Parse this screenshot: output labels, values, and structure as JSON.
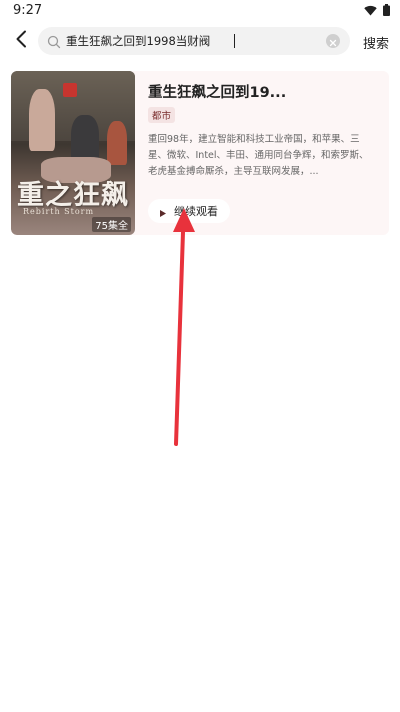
{
  "status_bar": {
    "time": "9:27",
    "icons": [
      "wifi-icon",
      "battery-icon"
    ]
  },
  "search": {
    "back_icon": "chevron-left-icon",
    "query": "重生狂飙之回到1998当财阀",
    "clear_icon": "clear-icon",
    "button_label": "搜索"
  },
  "result": {
    "poster_title_art": "重之狂飙",
    "poster_subtitle_art": "Rebirth Storm",
    "episode_badge": "75集全",
    "title": "重生狂飙之回到19...",
    "genre": "都市",
    "description": "重回98年，建立智能和科技工业帝国，和苹果、三星、微软、Intel、丰田、通用同台争辉，和索罗斯、老虎基金搏命厮杀，主导互联网发展，...",
    "continue_label": "继续观看"
  },
  "colors": {
    "card_background": "#fdf6f6",
    "genre_tag_background": "#f4e3e3",
    "genre_tag_text": "#7a2e2e",
    "search_background": "#f2f2f2",
    "annotation_arrow": "#e8323c"
  }
}
